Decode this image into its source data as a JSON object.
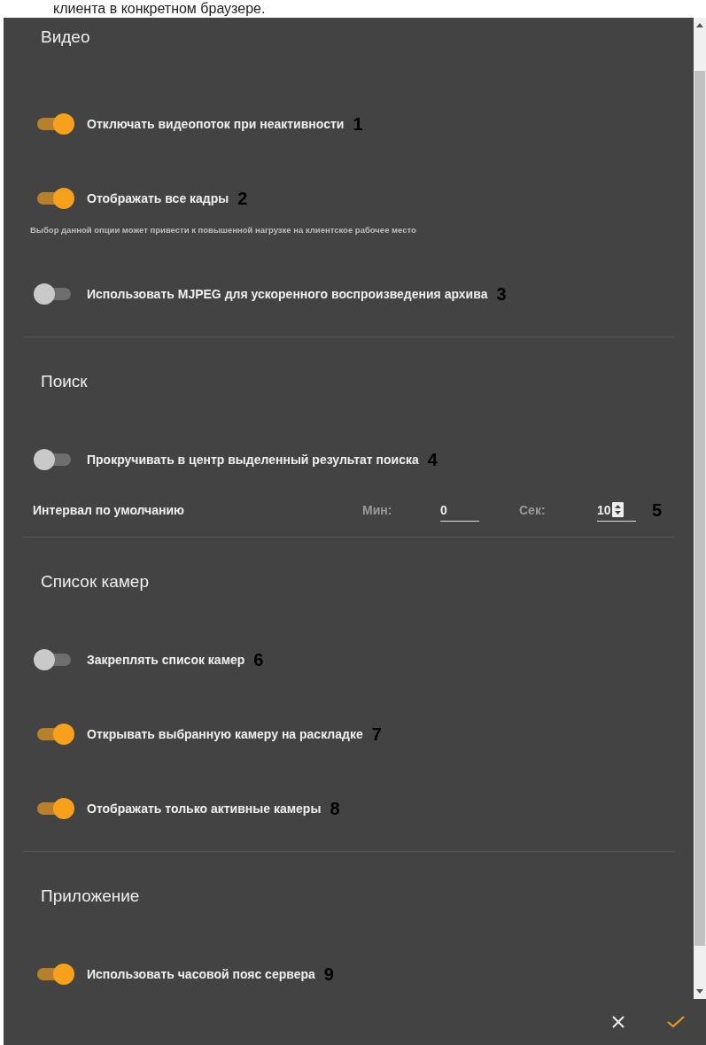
{
  "page_text": "клиента в конкретном браузере.",
  "sections": [
    {
      "title": "Видео",
      "items": [
        {
          "kind": "toggle",
          "label": "Отключать видеопоток при неактивности",
          "on": true,
          "marker": "1"
        },
        {
          "kind": "toggle",
          "label": "Отображать все кадры",
          "on": true,
          "marker": "2",
          "hint": "Выбор данной опции может привести к повышенной нагрузке на клиентское рабочее место"
        },
        {
          "kind": "toggle",
          "label": "Использовать MJPEG для ускоренного воспроизведения архива",
          "on": false,
          "marker": "3"
        }
      ]
    },
    {
      "title": "Поиск",
      "items": [
        {
          "kind": "toggle",
          "label": "Прокручивать в центр выделенный результат поиска",
          "on": false,
          "marker": "4"
        },
        {
          "kind": "interval",
          "label": "Интервал по умолчанию",
          "marker": "5",
          "fields": [
            {
              "label": "Мин:",
              "value": "0",
              "spinner": false
            },
            {
              "label": "Сек:",
              "value": "10",
              "spinner": true
            }
          ]
        }
      ]
    },
    {
      "title": "Список камер",
      "items": [
        {
          "kind": "toggle",
          "label": "Закреплять список камер",
          "on": false,
          "marker": "6"
        },
        {
          "kind": "toggle",
          "label": "Открывать выбранную камеру на раскладке",
          "on": true,
          "marker": "7"
        },
        {
          "kind": "toggle",
          "label": "Отображать только активные камеры",
          "on": true,
          "marker": "8"
        }
      ]
    },
    {
      "title": "Приложение",
      "items": [
        {
          "kind": "toggle",
          "label": "Использовать часовой пояс сервера",
          "on": true,
          "marker": "9"
        }
      ]
    }
  ]
}
